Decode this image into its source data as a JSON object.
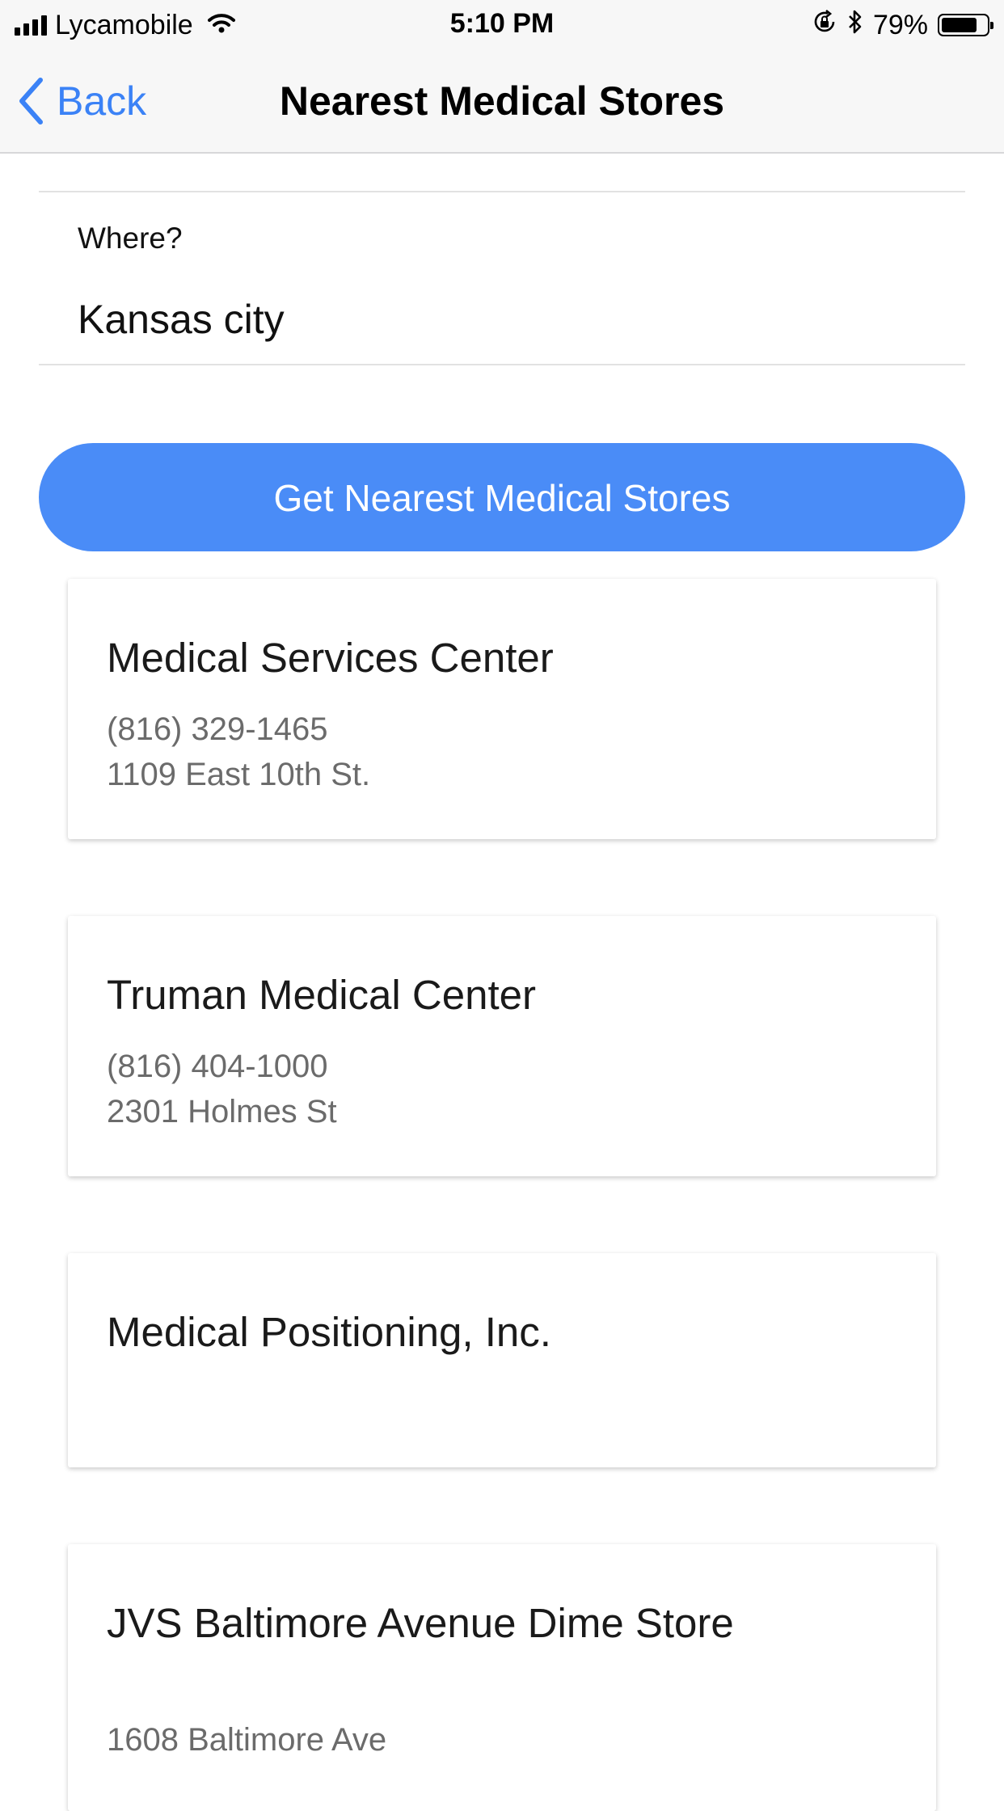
{
  "status_bar": {
    "carrier": "Lycamobile",
    "time": "5:10 PM",
    "battery_percent": "79%",
    "battery_level": 0.79,
    "icons": [
      "signal-icon",
      "wifi-icon",
      "rotation-lock-icon",
      "bluetooth-icon",
      "battery-icon"
    ]
  },
  "nav": {
    "back_label": "Back",
    "title": "Nearest Medical Stores"
  },
  "form": {
    "where_label": "Where?",
    "where_value": "Kansas city"
  },
  "action": {
    "button_label": "Get Nearest Medical Stores"
  },
  "stores": [
    {
      "name": "Medical Services Center",
      "phone": "(816) 329-1465",
      "address": "1109 East 10th St."
    },
    {
      "name": "Truman Medical Center",
      "phone": "(816) 404-1000",
      "address": "2301 Holmes St"
    },
    {
      "name": "Medical Positioning, Inc.",
      "phone": "",
      "address": ""
    },
    {
      "name": "JVS Baltimore Avenue Dime Store",
      "phone": "",
      "address": "1608 Baltimore Ave"
    }
  ],
  "colors": {
    "accent": "#3b82f6",
    "button": "#4a8cf7",
    "bar_background": "#f7f7f7"
  }
}
